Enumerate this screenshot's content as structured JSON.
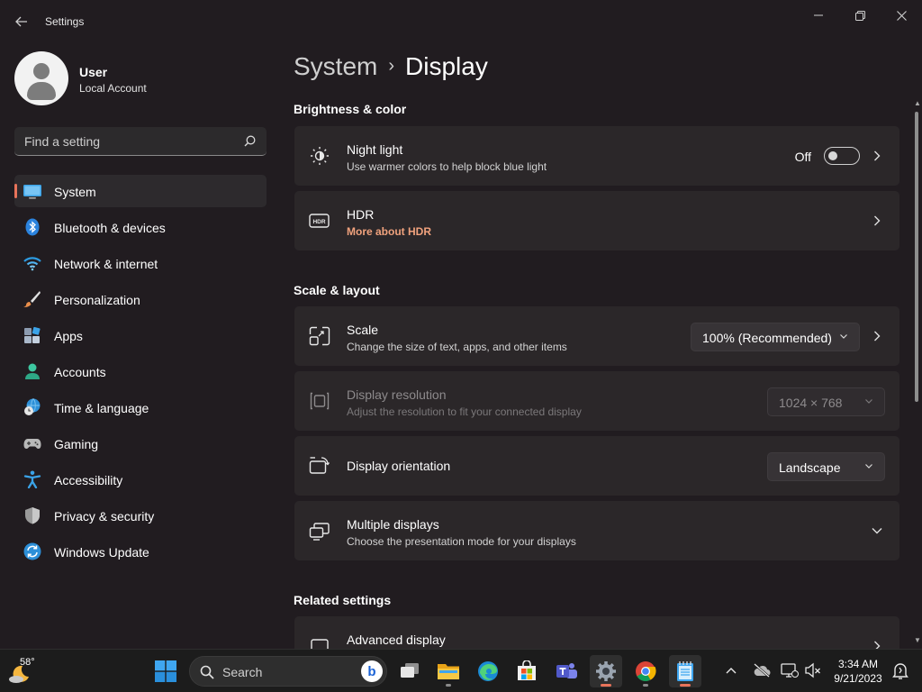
{
  "window": {
    "app_title": "Settings"
  },
  "profile": {
    "name": "User",
    "account_type": "Local Account"
  },
  "search": {
    "placeholder": "Find a setting"
  },
  "nav": {
    "items": [
      {
        "label": "System",
        "icon": "system-icon",
        "active": true
      },
      {
        "label": "Bluetooth & devices",
        "icon": "bluetooth-icon"
      },
      {
        "label": "Network & internet",
        "icon": "wifi-icon"
      },
      {
        "label": "Personalization",
        "icon": "brush-icon"
      },
      {
        "label": "Apps",
        "icon": "apps-icon"
      },
      {
        "label": "Accounts",
        "icon": "person-icon"
      },
      {
        "label": "Time & language",
        "icon": "globe-clock-icon"
      },
      {
        "label": "Gaming",
        "icon": "gamepad-icon"
      },
      {
        "label": "Accessibility",
        "icon": "accessibility-icon"
      },
      {
        "label": "Privacy & security",
        "icon": "shield-icon"
      },
      {
        "label": "Windows Update",
        "icon": "update-icon"
      }
    ]
  },
  "page": {
    "breadcrumb_parent": "System",
    "breadcrumb_sep": "›",
    "title": "Display"
  },
  "sections": {
    "brightness": "Brightness & color",
    "scale": "Scale & layout",
    "related": "Related settings"
  },
  "cards": {
    "night_light": {
      "title": "Night light",
      "subtitle": "Use warmer colors to help block blue light",
      "toggle_state": "Off",
      "toggle_on": false
    },
    "hdr": {
      "title": "HDR",
      "link": "More about HDR"
    },
    "scale": {
      "title": "Scale",
      "subtitle": "Change the size of text, apps, and other items",
      "value": "100% (Recommended)"
    },
    "resolution": {
      "title": "Display resolution",
      "subtitle": "Adjust the resolution to fit your connected display",
      "value": "1024 × 768",
      "disabled": true
    },
    "orientation": {
      "title": "Display orientation",
      "value": "Landscape"
    },
    "multiple": {
      "title": "Multiple displays",
      "subtitle": "Choose the presentation mode for your displays"
    },
    "advanced": {
      "title": "Advanced display"
    }
  },
  "taskbar": {
    "weather_temp": "58°",
    "search_label": "Search",
    "bing_letter": "b",
    "time": "3:34 AM",
    "date": "9/21/2023"
  },
  "colors": {
    "accent": "#e8735a",
    "link": "#f0a27d",
    "background": "#211c20",
    "card": "#2b2729"
  }
}
